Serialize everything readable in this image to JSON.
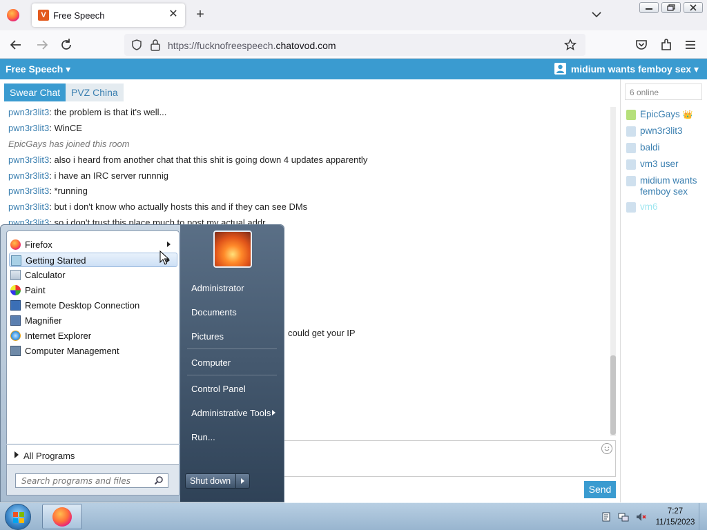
{
  "browser": {
    "tab": {
      "title": "Free Speech",
      "favicon_letter": "V"
    },
    "url": {
      "prefix": "https://fucknofreespeech.",
      "domain": "chatovod.com"
    }
  },
  "chat": {
    "room_title": "Free Speech ▾",
    "user_menu": "midium wants femboy sex ▾",
    "room_tabs": [
      "Swear Chat",
      "PVZ China"
    ],
    "messages": [
      {
        "nick": "pwn3r3lit3",
        "text": ": the problem is that it's well..."
      },
      {
        "nick": "pwn3r3lit3",
        "text": ": WinCE"
      },
      {
        "system": "EpicGays has joined this room"
      },
      {
        "nick": "pwn3r3lit3",
        "text": ": also i heard from another chat that this shit is going down 4 updates apparently"
      },
      {
        "nick": "pwn3r3lit3",
        "text": ": i have an IRC server runnnig"
      },
      {
        "nick": "pwn3r3lit3",
        "text": ": *running"
      },
      {
        "nick": "pwn3r3lit3",
        "text": ": but i don't know who actually hosts this and if they can see DMs"
      },
      {
        "nick": "pwn3r3lit3",
        "text": ": so i don't trust this place much to post my actual addr"
      }
    ],
    "partial_message": "could get your IP",
    "send_label": "Send",
    "online_count": "6 online",
    "users": [
      "EpicGays",
      "pwn3r3lit3",
      "baldi",
      "vm3 user",
      "midium wants femboy sex",
      "vm6"
    ],
    "owner_badge": "👑"
  },
  "start_menu": {
    "programs": [
      "Firefox",
      "Getting Started",
      "Calculator",
      "Paint",
      "Remote Desktop Connection",
      "Magnifier",
      "Internet Explorer",
      "Computer Management"
    ],
    "all_programs": "All Programs",
    "search_placeholder": "Search programs and files",
    "right_items": [
      "Administrator",
      "Documents",
      "Pictures",
      "Computer",
      "Control Panel",
      "Administrative Tools",
      "Run..."
    ],
    "shutdown": "Shut down"
  },
  "taskbar": {
    "time": "7:27",
    "date": "11/15/2023"
  },
  "colors": {
    "accent": "#3a9bd0",
    "nick": "#3a7fb0"
  }
}
